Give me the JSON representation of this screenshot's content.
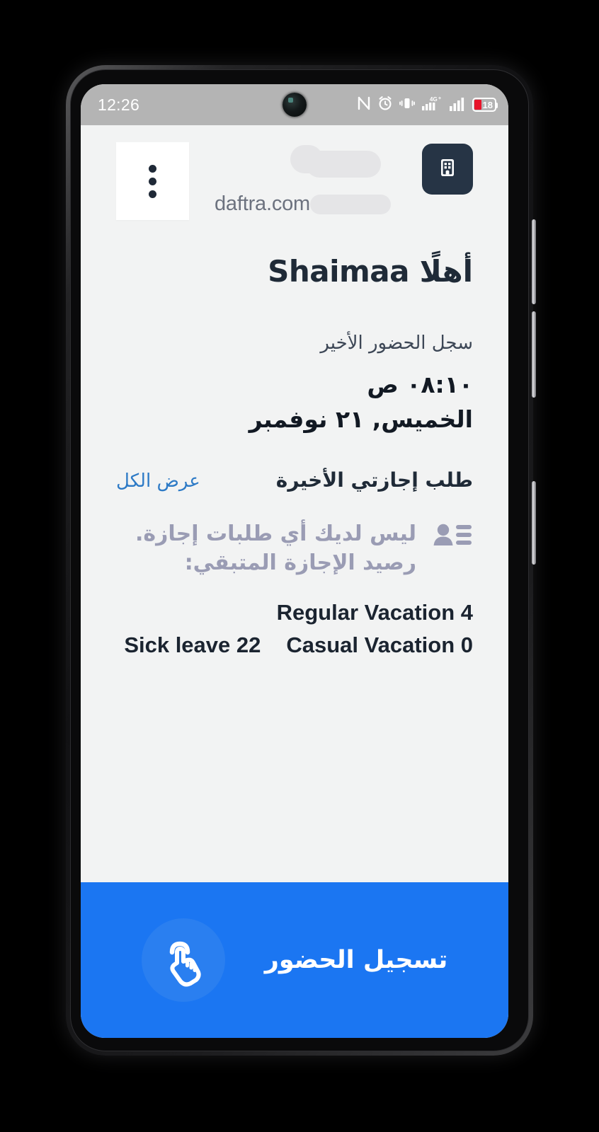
{
  "status_bar": {
    "time": "12:26",
    "icons": [
      "nfc-icon",
      "alarm-icon",
      "vibrate-icon",
      "signal-4g-plus-icon",
      "signal-bars-icon"
    ],
    "battery_percent": "18"
  },
  "header": {
    "menu_icon": "more-vertical-icon",
    "domain_text": "daftra.com",
    "subdomain_redacted": "",
    "org_icon": "building-icon"
  },
  "greeting": {
    "text": "أهلًا Shaimaa"
  },
  "attendance": {
    "label": "سجل الحضور الأخير",
    "time": "٠٨:١٠ ص",
    "date": "الخميس, ٢١ نوفمبر"
  },
  "leave": {
    "title": "طلب إجازتي الأخيرة",
    "view_all": "عرض الكل",
    "empty_icon": "contact-list-icon",
    "empty_message": "ليس لديك أي طلبات إجازة.",
    "balance_label": "رصيد الإجازة المتبقي:",
    "balances_row1": [
      "Regular Vacation 4"
    ],
    "balances_row2": [
      "Casual Vacation 0",
      "Sick leave 22"
    ]
  },
  "checkin": {
    "label": "تسجيل الحضور",
    "icon": "tap-hand-icon"
  },
  "nav_bar": {
    "back": "back-triangle-icon",
    "home": "home-square-icon",
    "recents": "recents-menu-icon"
  },
  "colors": {
    "accent_blue": "#1b76f2",
    "link_blue": "#2d7ac6",
    "dark_navy": "#263445",
    "page_bg": "#f2f3f3",
    "muted_purple": "#9a9cb4",
    "battery_red": "#e8142a"
  }
}
